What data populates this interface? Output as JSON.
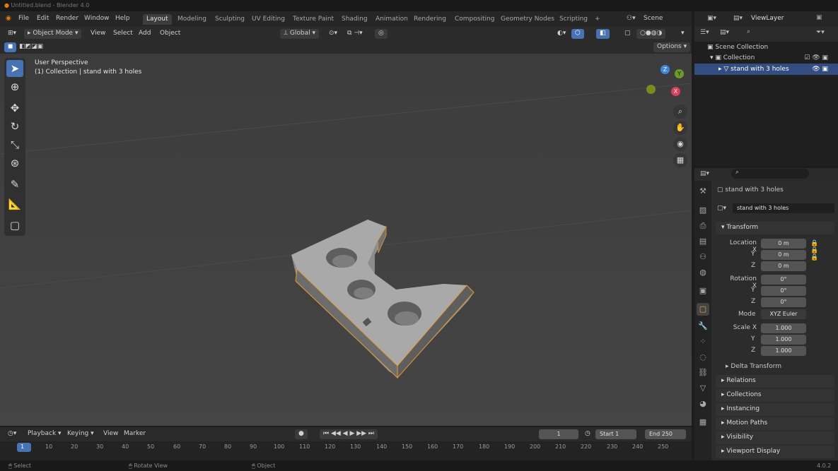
{
  "window": {
    "title": "Untitled.blend - Blender 4.0"
  },
  "menu": [
    "File",
    "Edit",
    "Render",
    "Window",
    "Help"
  ],
  "workspaces": [
    {
      "label": "Layout",
      "active": true
    },
    {
      "label": "Modeling"
    },
    {
      "label": "Sculpting"
    },
    {
      "label": "UV Editing"
    },
    {
      "label": "Texture Paint"
    },
    {
      "label": "Shading"
    },
    {
      "label": "Animation"
    },
    {
      "label": "Rendering"
    },
    {
      "label": "Compositing"
    },
    {
      "label": "Geometry Nodes"
    },
    {
      "label": "Scripting"
    }
  ],
  "scene": {
    "label": "Scene",
    "view_layer": "ViewLayer"
  },
  "viewport_header": {
    "mode": "Object Mode",
    "view": "View",
    "select": "Select",
    "add": "Add",
    "object": "Object",
    "transform": "Global",
    "options": "Options"
  },
  "viewport": {
    "perspective": "User Perspective",
    "context": "(1) Collection | stand with 3 holes",
    "gizmo": {
      "x": "X",
      "y": "Y",
      "z": "Z"
    }
  },
  "outliner": {
    "scene_collection": "Scene Collection",
    "collection": "Collection",
    "object": "stand with 3 holes"
  },
  "properties": {
    "object_name": "stand with 3 holes",
    "data_name": "stand with 3 holes",
    "transform_label": "Transform",
    "location_label": "Location X",
    "rotation_label": "Rotation X",
    "scale_label": "Scale X",
    "y": "Y",
    "z": "Z",
    "location": [
      "0 m",
      "0 m",
      "0 m"
    ],
    "rotation": [
      "0°",
      "0°",
      "0°"
    ],
    "scale": [
      "1.000",
      "1.000",
      "1.000"
    ],
    "mode_label": "Mode",
    "mode_value": "XYZ Euler",
    "delta": "Delta Transform",
    "panels": [
      "Relations",
      "Collections",
      "Instancing",
      "Motion Paths",
      "Visibility",
      "Viewport Display"
    ]
  },
  "timeline": {
    "playback": "Playback",
    "keying": "Keying",
    "view": "View",
    "marker": "Marker",
    "current": "1",
    "start_label": "Start",
    "start": "1",
    "end_label": "End",
    "end": "250",
    "ticks": [
      "1",
      "10",
      "20",
      "30",
      "40",
      "50",
      "60",
      "70",
      "80",
      "90",
      "100",
      "110",
      "120",
      "130",
      "140",
      "150",
      "160",
      "170",
      "180",
      "190",
      "200",
      "210",
      "220",
      "230",
      "240",
      "250"
    ]
  },
  "status": {
    "select": "Select",
    "rotate": "Rotate View",
    "object": "Object",
    "version": "4.0.2"
  }
}
